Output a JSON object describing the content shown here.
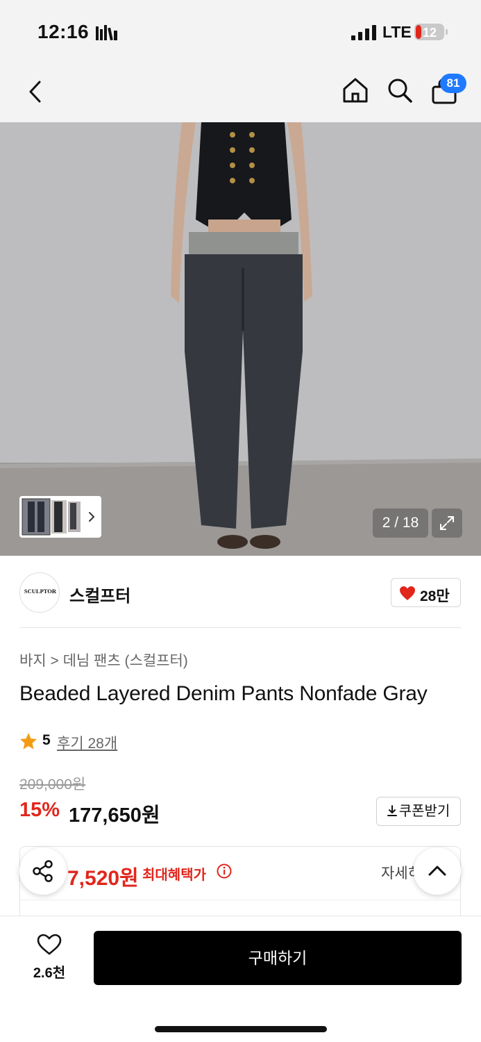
{
  "status_bar": {
    "time": "12:16",
    "network": "LTE",
    "battery": "12"
  },
  "header": {
    "cart_count": "81",
    "icons": [
      "back-icon",
      "home-icon",
      "search-icon",
      "cart-icon"
    ]
  },
  "gallery": {
    "counter": "2 / 18"
  },
  "brand": {
    "logo_text": "SCULPTOR",
    "name": "스컬프터",
    "likes": "28만"
  },
  "product": {
    "breadcrumb": "바지 > 데님 팬츠 (스컬프터)",
    "title": "Beaded Layered Denim Pants Nonfade Gray",
    "rating": "5",
    "reviews": "후기 28개",
    "original_price": "209,000원",
    "discount": "15%",
    "sale_price": "177,650원",
    "coupon_label": "쿠폰받기"
  },
  "benefit": {
    "price": "7,520원",
    "label": "최대혜택가",
    "detail": "자세히"
  },
  "bottom_bar": {
    "wish_count": "2.6천",
    "buy_label": "구매하기"
  },
  "colors": {
    "accent_red": "#e1261c",
    "badge_blue": "#1f7aff",
    "buy_black": "#000000"
  }
}
